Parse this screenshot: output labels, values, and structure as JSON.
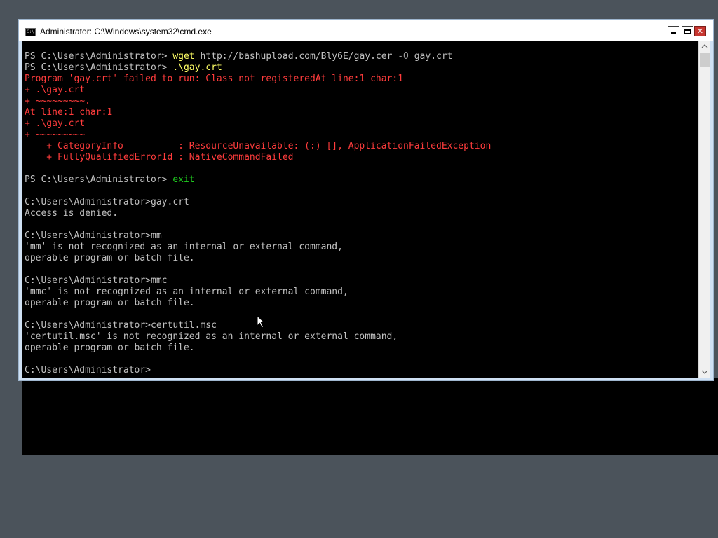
{
  "window": {
    "title": "Administrator: C:\\Windows\\system32\\cmd.exe",
    "icon": "cmd-icon",
    "icon_label": "C:\\"
  },
  "controls": {
    "minimize": "minimize-icon",
    "maximize": "maximize-icon",
    "close": "close-icon",
    "close_glyph": "✕"
  },
  "colors": {
    "background": "#4b535b",
    "console_bg": "#000000",
    "default_text": "#c0c0c0",
    "error_text": "#ff3c3c",
    "cmdlet_text": "#ffff66",
    "param_text": "#9a9a9a",
    "exit_text": "#20d020",
    "close_button": "#c7352f"
  },
  "console": {
    "lines": [
      [
        {
          "t": "PS C:\\Users\\Administrator> ",
          "c": "default"
        },
        {
          "t": "wget",
          "c": "cmd"
        },
        {
          "t": " http://bashupload.com/Bly6E/gay.cer ",
          "c": "default"
        },
        {
          "t": "-O",
          "c": "param"
        },
        {
          "t": " gay.crt",
          "c": "default"
        }
      ],
      [
        {
          "t": "PS C:\\Users\\Administrator> ",
          "c": "default"
        },
        {
          "t": ".\\gay.crt",
          "c": "cmd"
        }
      ],
      [
        {
          "t": "Program 'gay.crt' failed to run: Class not registeredAt line:1 char:1",
          "c": "err"
        }
      ],
      [
        {
          "t": "+ .\\gay.crt",
          "c": "err"
        }
      ],
      [
        {
          "t": "+ ~~~~~~~~~.",
          "c": "err"
        }
      ],
      [
        {
          "t": "At line:1 char:1",
          "c": "err"
        }
      ],
      [
        {
          "t": "+ .\\gay.crt",
          "c": "err"
        }
      ],
      [
        {
          "t": "+ ~~~~~~~~~",
          "c": "err"
        }
      ],
      [
        {
          "t": "    + CategoryInfo          : ResourceUnavailable: (:) [], ApplicationFailedException",
          "c": "err"
        }
      ],
      [
        {
          "t": "    + FullyQualifiedErrorId : NativeCommandFailed",
          "c": "err"
        }
      ],
      [],
      [
        {
          "t": "PS C:\\Users\\Administrator> ",
          "c": "default"
        },
        {
          "t": "exit",
          "c": "green"
        }
      ],
      [],
      [
        {
          "t": "C:\\Users\\Administrator>gay.crt",
          "c": "default"
        }
      ],
      [
        {
          "t": "Access is denied.",
          "c": "default"
        }
      ],
      [],
      [
        {
          "t": "C:\\Users\\Administrator>mm",
          "c": "default"
        }
      ],
      [
        {
          "t": "'mm' is not recognized as an internal or external command,",
          "c": "default"
        }
      ],
      [
        {
          "t": "operable program or batch file.",
          "c": "default"
        }
      ],
      [],
      [
        {
          "t": "C:\\Users\\Administrator>mmc",
          "c": "default"
        }
      ],
      [
        {
          "t": "'mmc' is not recognized as an internal or external command,",
          "c": "default"
        }
      ],
      [
        {
          "t": "operable program or batch file.",
          "c": "default"
        }
      ],
      [],
      [
        {
          "t": "C:\\Users\\Administrator>certutil.msc",
          "c": "default"
        }
      ],
      [
        {
          "t": "'certutil.msc' is not recognized as an internal or external command,",
          "c": "default"
        }
      ],
      [
        {
          "t": "operable program or batch file.",
          "c": "default"
        }
      ],
      [],
      [
        {
          "t": "C:\\Users\\Administrator>",
          "c": "default"
        }
      ]
    ]
  },
  "scrollbar": {
    "up_arrow": "^",
    "down_arrow": "v",
    "up_icon": "chevron-up-icon",
    "down_icon": "chevron-down-icon"
  },
  "pointer": "mouse-cursor-icon"
}
